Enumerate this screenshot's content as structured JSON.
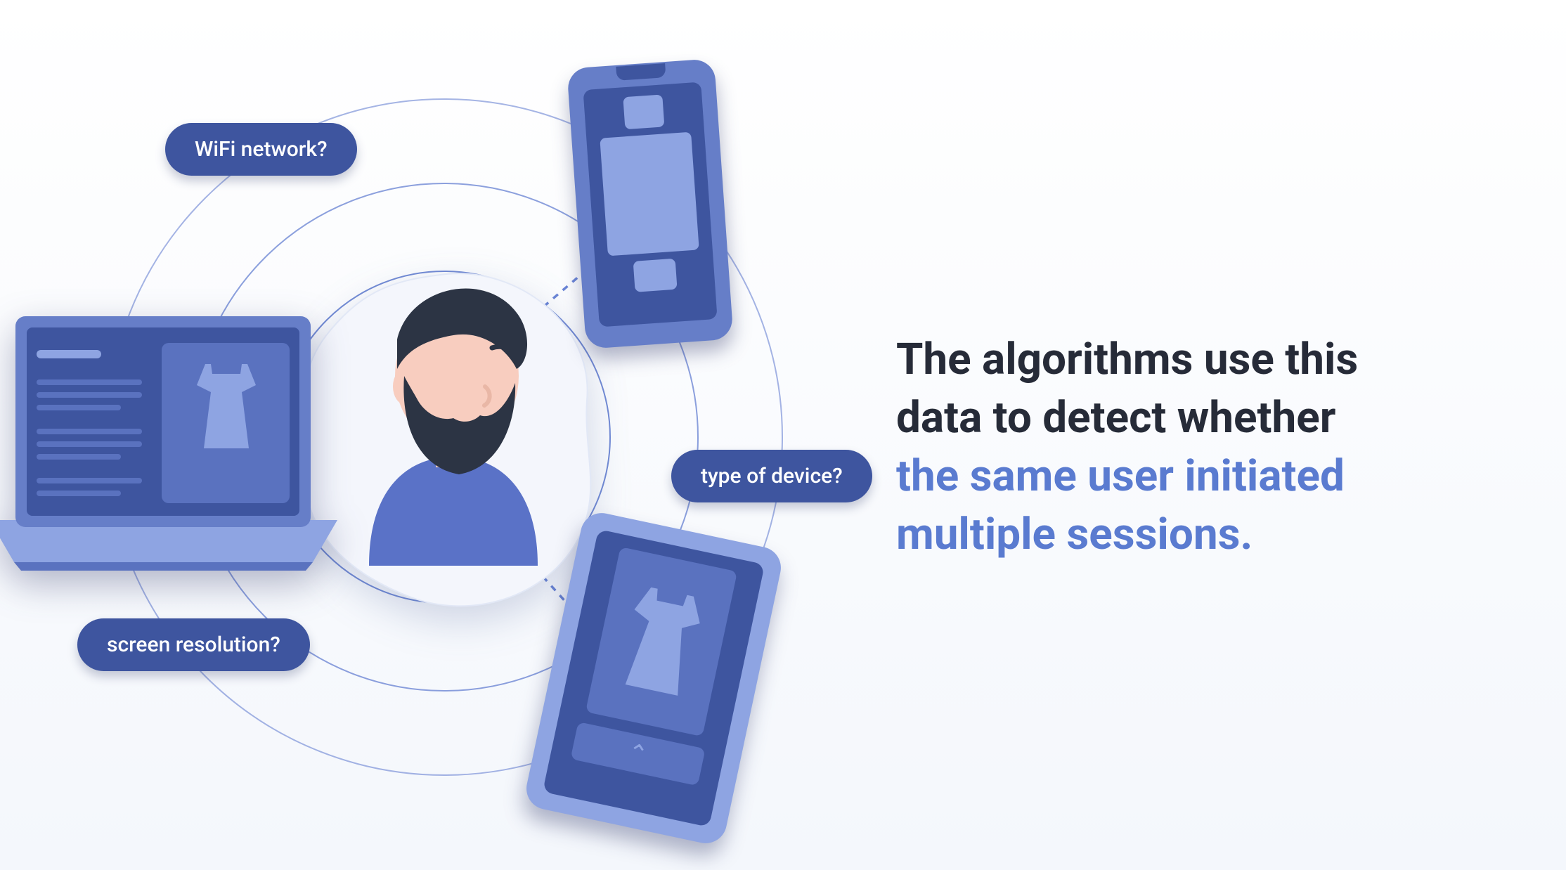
{
  "labels": {
    "wifi": "WiFi network?",
    "screen": "screen resolution?",
    "device": "type of device?"
  },
  "caption": {
    "line1": "The algorithms use this",
    "line2": "data to detect whether",
    "line3": "the same user initiated",
    "line4": "multiple sessions."
  },
  "colors": {
    "pill_bg": "#3E559F",
    "pill_text": "#ffffff",
    "orbit_stroke": "#5B77CE",
    "accent_text": "#5A7BD0",
    "body_text": "#262B38",
    "device_body_light": "#8EA4E2",
    "device_body_mid": "#667EC8",
    "device_screen": "#3E559F"
  },
  "icons": {
    "person": "bearded-person-avatar",
    "laptop": "laptop-device-icon",
    "phone": "smartphone-device-icon",
    "tablet": "tablet-device-icon",
    "product": "dress-product-icon",
    "check": "chevron-down-icon"
  }
}
